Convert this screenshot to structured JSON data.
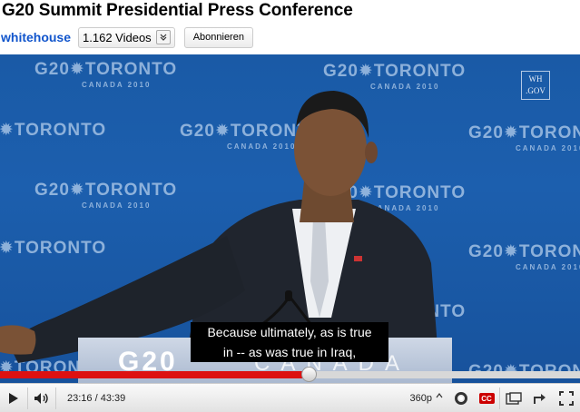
{
  "header": {
    "title": "G20 Summit Presidential Press Conference",
    "channel": "whitehouse",
    "videos_label": "1.162 Videos",
    "subscribe_label": "Abonnieren"
  },
  "video": {
    "backdrop_logo": "G20✹TORONTO",
    "backdrop_sub": "CANADA 2010",
    "watermark_line1": "WH",
    "watermark_line2": ".GOV",
    "podium_logo": "G20",
    "podium_sub": "CANADA"
  },
  "captions": {
    "line1": "Because ultimately, as is true",
    "line2": "in -- as was true in Iraq,"
  },
  "player": {
    "progress_fraction": 0.532,
    "current_time": "23:16",
    "duration": "43:39",
    "time_separator": " / ",
    "quality": "360p",
    "cc_label": "CC",
    "accent_color": "#dd1111"
  }
}
